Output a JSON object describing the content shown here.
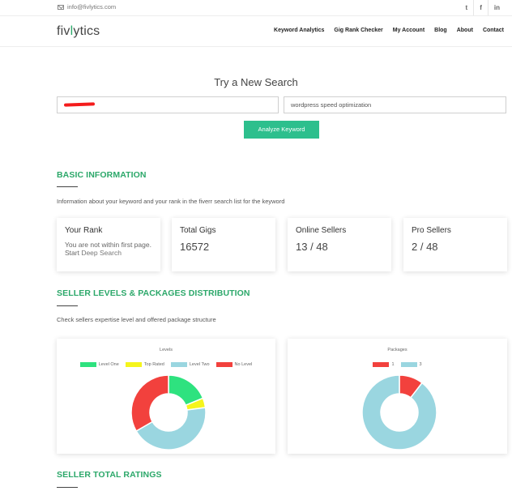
{
  "topbar": {
    "email": "info@fivlytics.com",
    "social": [
      "t",
      "f",
      "in"
    ]
  },
  "brand": {
    "logo_pre": "fiv",
    "logo_mid": "l",
    "logo_post": "ytics"
  },
  "nav": {
    "items": [
      "Keyword Analytics",
      "Gig Rank Checker",
      "My Account",
      "Blog",
      "About",
      "Contact"
    ]
  },
  "search": {
    "title": "Try a New Search",
    "keyword_value": "wordpress speed optimization",
    "analyze_label": "Analyze Keyword"
  },
  "basic": {
    "title": "BASIC INFORMATION",
    "desc": "Information about your keyword and your rank in the fiverr search list for the keyword",
    "cards": [
      {
        "title": "Your Rank",
        "text": "You are not within first page. Start ",
        "link": "Deep Search"
      },
      {
        "title": "Total Gigs",
        "value": "16572"
      },
      {
        "title": "Online Sellers",
        "value": "13 / 48"
      },
      {
        "title": "Pro Sellers",
        "value": "2 / 48"
      }
    ]
  },
  "levels_section": {
    "title": "SELLER LEVELS & PACKAGES DISTRIBUTION",
    "desc": "Check sellers expertise level and offered package structure"
  },
  "ratings_section": {
    "title": "SELLER TOTAL RATINGS"
  },
  "chart_data": [
    {
      "type": "pie",
      "title": "Levels",
      "categories": [
        "Level One",
        "Top Rated",
        "Level Two",
        "No Level"
      ],
      "values": [
        9,
        2,
        21,
        16
      ],
      "colors": [
        "#2ee27f",
        "#f5f51c",
        "#9ad6e0",
        "#f2413d"
      ],
      "legend": "top"
    },
    {
      "type": "pie",
      "title": "Packages",
      "categories": [
        "1",
        "3"
      ],
      "values": [
        5,
        43
      ],
      "colors": [
        "#f2413d",
        "#9ad6e0"
      ],
      "legend": "top"
    }
  ]
}
